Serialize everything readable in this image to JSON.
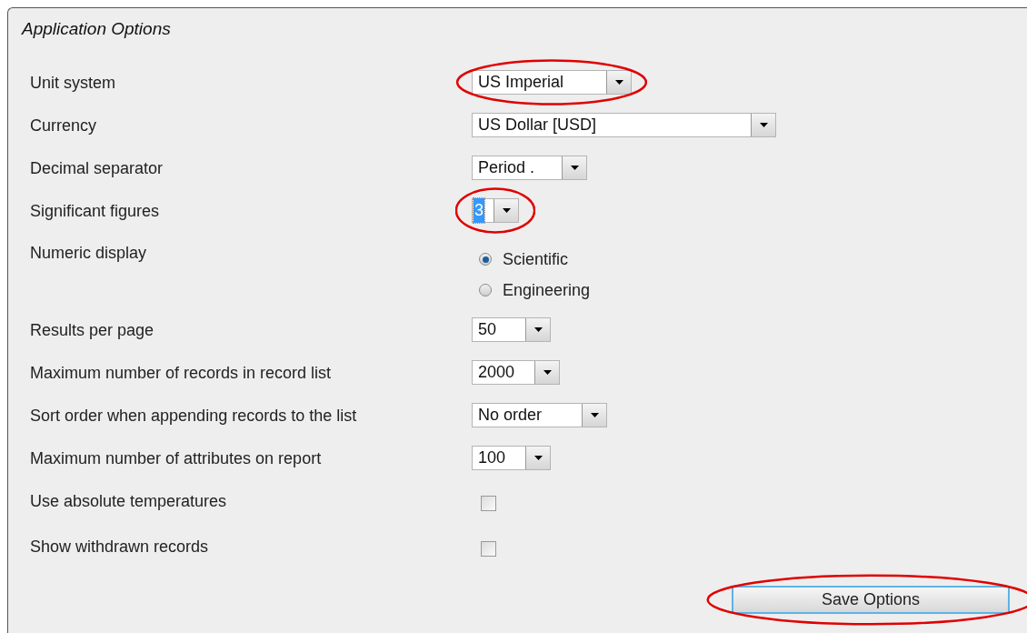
{
  "panel": {
    "title": "Application Options"
  },
  "rows": [
    {
      "kind": "select",
      "label": "Unit system",
      "value": "US Imperial",
      "highlighted": true,
      "focused": false
    },
    {
      "kind": "select",
      "label": "Currency",
      "value": "US Dollar [USD]",
      "highlighted": false,
      "focused": false
    },
    {
      "kind": "select",
      "label": "Decimal separator",
      "value": "Period .",
      "highlighted": false,
      "focused": false
    },
    {
      "kind": "select",
      "label": "Significant figures",
      "value": "3",
      "highlighted": true,
      "focused": true
    },
    {
      "kind": "radio",
      "label": "Numeric display",
      "highlighted": false,
      "options": [
        {
          "label": "Scientific",
          "selected": true
        },
        {
          "label": "Engineering",
          "selected": false
        }
      ]
    },
    {
      "kind": "select",
      "label": "Results per page",
      "value": "50",
      "highlighted": false,
      "focused": false
    },
    {
      "kind": "select",
      "label": "Maximum number of records in record list",
      "value": "2000",
      "highlighted": false,
      "focused": false
    },
    {
      "kind": "select",
      "label": "Sort order when appending records to the list",
      "value": "No order",
      "highlighted": false,
      "focused": false
    },
    {
      "kind": "select",
      "label": "Maximum number of attributes on report",
      "value": "100",
      "highlighted": false,
      "focused": false
    },
    {
      "kind": "checkbox",
      "label": "Use absolute temperatures",
      "checked": false,
      "highlighted": false
    },
    {
      "kind": "checkbox",
      "label": "Show withdrawn records",
      "checked": false,
      "highlighted": false
    }
  ],
  "save_button": {
    "label": "Save Options",
    "highlighted": true
  }
}
